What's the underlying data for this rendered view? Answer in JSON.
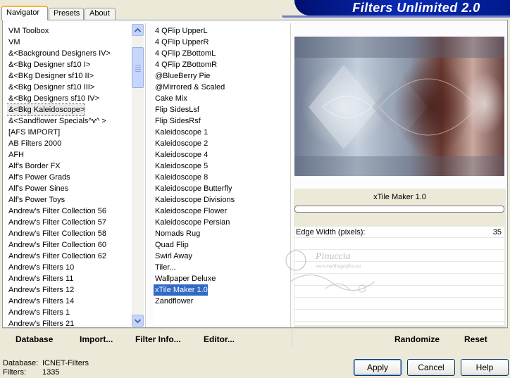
{
  "tabs": [
    {
      "label": "Navigator",
      "active": true
    },
    {
      "label": "Presets",
      "active": false
    },
    {
      "label": "About",
      "active": false
    }
  ],
  "banner": {
    "title": "Filters Unlimited 2.0"
  },
  "categories": [
    "VM Toolbox",
    "VM",
    "&<Background Designers IV>",
    "&<Bkg Designer sf10 I>",
    "&<BKg Designer sf10 II>",
    "&<Bkg Designer sf10 III>",
    "&<Bkg Designers sf10 IV>",
    "&<Bkg Kaleidoscope>",
    "&<Sandflower Specials^v^ >",
    "[AFS IMPORT]",
    "AB Filters 2000",
    "AFH",
    "Alf's Border FX",
    "Alf's Power Grads",
    "Alf's Power Sines",
    "Alf's Power Toys",
    "Andrew's Filter Collection 56",
    "Andrew's Filter Collection 57",
    "Andrew's Filter Collection 58",
    "Andrew's Filter Collection 60",
    "Andrew's Filter Collection 62",
    "Andrew's Filters 10",
    "Andrew's Filters 11",
    "Andrew's Filters 12",
    "Andrew's Filters 14",
    "Andrew's Filters 1",
    "Andrew's Filters 21"
  ],
  "selected_category_index": 7,
  "filters": [
    "4 QFlip UpperL",
    "4 QFlip UpperR",
    "4 QFlip ZBottomL",
    "4 QFlip ZBottomR",
    "@BlueBerry Pie",
    "@Mirrored & Scaled",
    "Cake Mix",
    "Flip SidesLsf",
    "Flip SidesRsf",
    "Kaleidoscope 1",
    "Kaleidoscope 2",
    "Kaleidoscope 4",
    "Kaleidoscope 5",
    "Kaleidoscope 8",
    "Kaleidoscope Butterfly",
    "Kaleidoscope Divisions",
    "Kaleidoscope Flower",
    "Kaleidoscope Persian",
    "Nomads Rug",
    "Quad Flip",
    "Swirl Away",
    "Tiler...",
    "Wallpaper Deluxe",
    "xTile Maker 1.0",
    "Zandflower"
  ],
  "selected_filter_index": 23,
  "filter_panel": {
    "name": "xTile Maker 1.0",
    "param_label": "Edge Width (pixels):",
    "param_value": "35"
  },
  "toolbar": {
    "database": "Database",
    "import": "Import...",
    "filter_info": "Filter Info...",
    "editor": "Editor...",
    "randomize": "Randomize",
    "reset": "Reset"
  },
  "status": {
    "database_label": "Database:",
    "database_value": "ICNET-Filters",
    "filters_label": "Filters:",
    "filters_value": "1335"
  },
  "buttons": {
    "apply": "Apply",
    "cancel": "Cancel",
    "help": "Help"
  },
  "watermark": {
    "line1": "Pinuccia",
    "line2": "www.maldragrafica.eu"
  },
  "colors": {
    "accent": "#316ac5",
    "banner": "#001a8c",
    "tab_highlight": "#f9b53d"
  }
}
